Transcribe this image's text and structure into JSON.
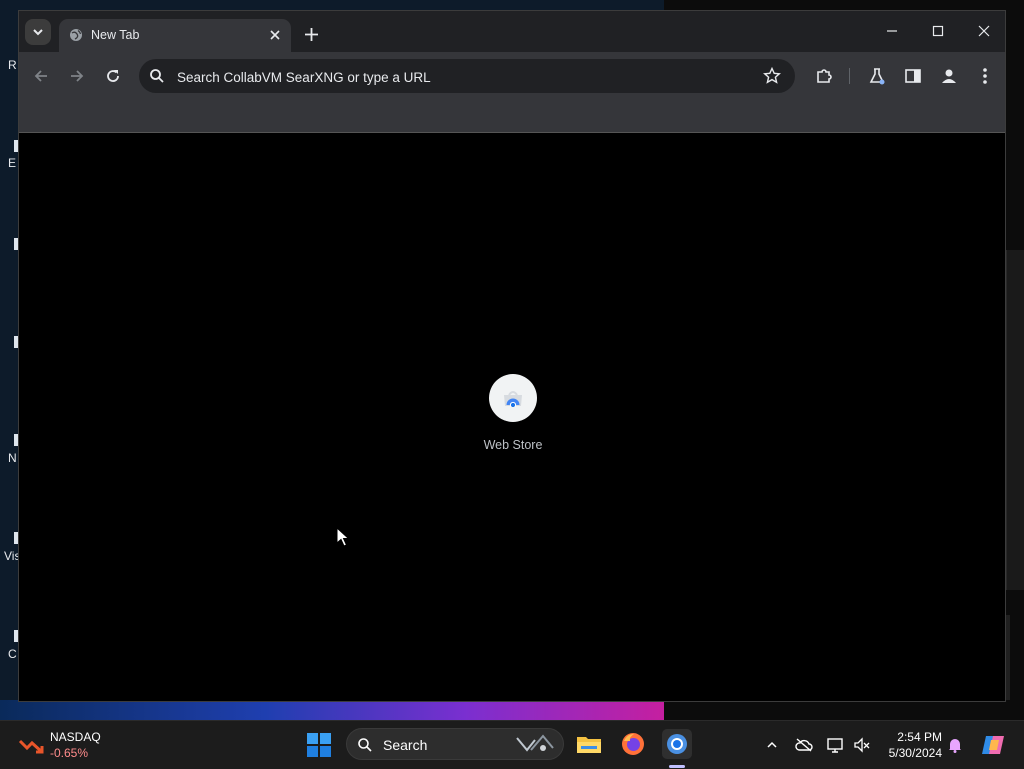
{
  "desktop": {
    "labels": [
      "R",
      "E",
      "N",
      "Vis",
      "C"
    ]
  },
  "browser": {
    "tab": {
      "title": "New Tab"
    },
    "omnibox": {
      "placeholder": "Search CollabVM SearXNG or type a URL"
    },
    "shortcuts": [
      {
        "label": "Web Store",
        "icon": "chrome-web-store-icon"
      }
    ]
  },
  "taskbar": {
    "widget": {
      "name": "NASDAQ",
      "value": "-0.65%"
    },
    "search_label": "Search",
    "clock": {
      "time": "2:54 PM",
      "date": "5/30/2024"
    }
  },
  "colors": {
    "tabstrip": "#202124",
    "toolbar": "#35363a",
    "taskbar": "#1c1c1c",
    "accent": "#0078d4",
    "stock_negative": "#ff8c8c"
  }
}
